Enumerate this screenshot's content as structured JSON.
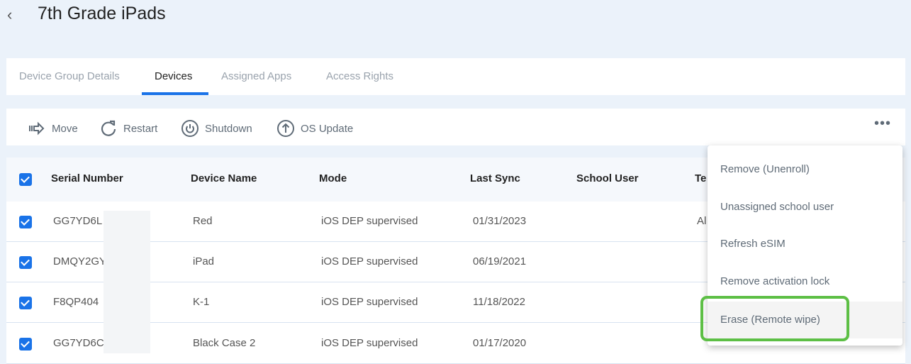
{
  "header": {
    "back_icon": "chevron-left-icon",
    "title": "7th Grade iPads"
  },
  "tabs": [
    {
      "label": "Device Group Details"
    },
    {
      "label": "Devices",
      "active": true
    },
    {
      "label": "Assigned Apps"
    },
    {
      "label": "Access Rights"
    }
  ],
  "toolbar": {
    "move": "Move",
    "restart": "Restart",
    "shutdown": "Shutdown",
    "os_update": "OS Update",
    "more": "•••"
  },
  "table": {
    "headers": {
      "serial": "Serial Number",
      "name": "Device Name",
      "mode": "Mode",
      "sync": "Last Sync",
      "user": "School User",
      "te": "Te"
    },
    "rows": [
      {
        "checked": true,
        "serial": "GG7YD6L",
        "name": "Red",
        "mode": "iOS DEP supervised",
        "sync": "01/31/2023",
        "te": "Al"
      },
      {
        "checked": true,
        "serial": "DMQY2GY",
        "name": "iPad",
        "mode": "iOS DEP supervised",
        "sync": "06/19/2021"
      },
      {
        "checked": true,
        "serial": "F8QP404",
        "name": "K-1",
        "mode": "iOS DEP supervised",
        "sync": "11/18/2022"
      },
      {
        "checked": true,
        "serial": "GG7YD6C",
        "name": "Black Case 2",
        "mode": "iOS DEP supervised",
        "sync": "01/17/2020"
      }
    ]
  },
  "menu": {
    "items": [
      {
        "label": "Remove (Unenroll)"
      },
      {
        "label": "Unassigned school user"
      },
      {
        "label": "Refresh eSIM"
      },
      {
        "label": "Remove activation lock"
      },
      {
        "label": "Erase (Remote wipe)",
        "highlighted": true
      }
    ]
  },
  "colors": {
    "accent": "#1a73e8",
    "highlight_box": "#5dbf45"
  }
}
